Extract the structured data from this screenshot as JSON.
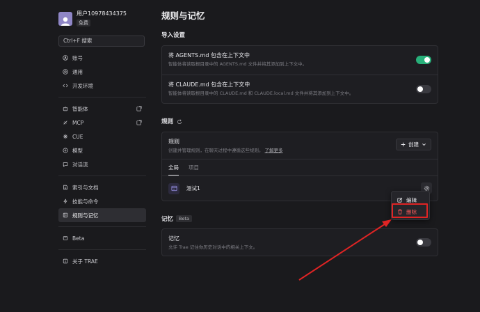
{
  "profile": {
    "username": "用户10978434375",
    "plan": "免费"
  },
  "search": {
    "label": "Ctrl+F 搜索"
  },
  "nav": {
    "group1": [
      {
        "label": "账号",
        "icon": "user-circle-icon"
      },
      {
        "label": "通用",
        "icon": "settings-icon"
      },
      {
        "label": "开发环境",
        "icon": "code-icon"
      }
    ],
    "group2": [
      {
        "label": "智能体",
        "icon": "agent-icon",
        "external": true
      },
      {
        "label": "MCP",
        "icon": "mcp-icon",
        "external": true
      },
      {
        "label": "CUE",
        "icon": "cue-icon"
      },
      {
        "label": "模型",
        "icon": "model-icon"
      },
      {
        "label": "对话流",
        "icon": "chat-flow-icon"
      }
    ],
    "group3": [
      {
        "label": "索引与文档",
        "icon": "index-icon"
      },
      {
        "label": "技能与命令",
        "icon": "skill-icon"
      },
      {
        "label": "规则与记忆",
        "icon": "rules-icon",
        "active": true
      }
    ],
    "group4": [
      {
        "label": "Beta",
        "icon": "beta-icon"
      }
    ],
    "group5": [
      {
        "label": "关于 TRAE",
        "icon": "info-icon"
      }
    ]
  },
  "page": {
    "title": "规则与记忆"
  },
  "import": {
    "title": "导入设置",
    "agents": {
      "title": "将 AGENTS.md 包含在上下文中",
      "desc": "智能体将读取根目录中的 AGENTS.md 文件并将其添加到上下文中。",
      "enabled": true
    },
    "claude": {
      "title": "将 CLAUDE.md 包含在上下文中",
      "desc": "智能体将读取根目录中的 CLAUDE.md 和 CLAUDE.local.md 文件并将其添加到上下文中。",
      "enabled": false
    }
  },
  "rules": {
    "title": "规则",
    "card_title": "规则",
    "desc": "创建并管理规则，在聊天过程中遵循这些规则。",
    "learn_more": "了解更多",
    "create_label": "创建",
    "tabs": [
      "全局",
      "项目"
    ],
    "items": [
      {
        "name": "测试1"
      }
    ]
  },
  "memory": {
    "title": "记忆",
    "beta": "Beta",
    "row_title": "记忆",
    "desc": "允许 Trae 记住你历史对话中的相关上下文。",
    "enabled": false
  },
  "context_menu": {
    "edit": "编辑",
    "delete": "删除"
  },
  "colors": {
    "accent_green": "#28b07a",
    "danger": "#ff5b5b",
    "annotation_red": "#e02424"
  }
}
